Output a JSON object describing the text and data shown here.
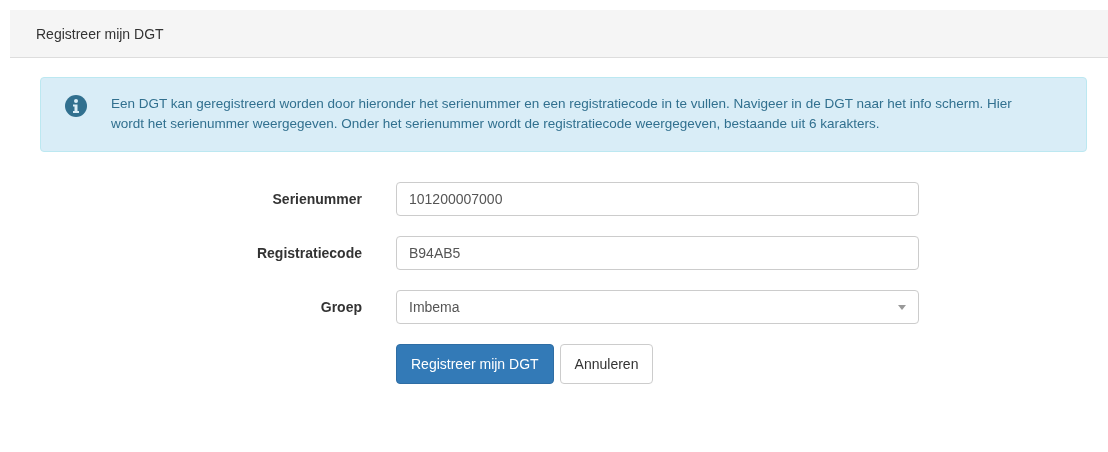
{
  "panel": {
    "title": "Registreer mijn DGT"
  },
  "alert": {
    "text": "Een DGT kan geregistreerd worden door hieronder het serienummer en een registratiecode in te vullen. Navigeer in de DGT naar het info scherm. Hier wordt het serienummer weergegeven. Onder het serienummer wordt de registratiecode weergegeven, bestaande uit 6 karakters."
  },
  "fields": [
    {
      "label": "Serienummer",
      "kind": "text",
      "value": "101200007000"
    },
    {
      "label": "Registratiecode",
      "kind": "text",
      "value": "B94AB5"
    },
    {
      "label": "Groep",
      "kind": "select",
      "value": "Imbema"
    }
  ],
  "buttons": [
    {
      "label": "Registreer mijn DGT",
      "kind": "primary"
    },
    {
      "label": "Annuleren",
      "kind": "default"
    }
  ]
}
